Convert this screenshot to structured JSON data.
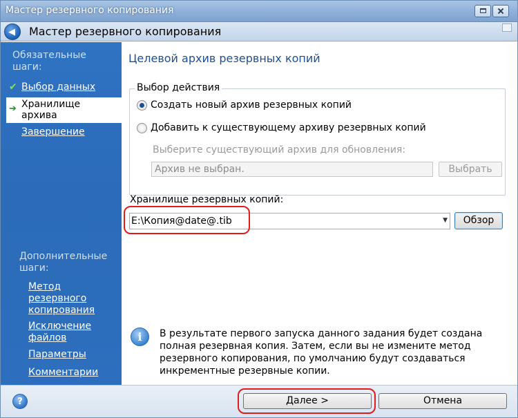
{
  "window": {
    "title": "Мастер резервного копирования",
    "header_title": "Мастер резервного копирования"
  },
  "sidebar": {
    "required_label": "Обязательные шаги:",
    "required_items": [
      {
        "label": "Выбор данных",
        "state": "completed"
      },
      {
        "label": "Хранилище архива",
        "state": "active"
      },
      {
        "label": "Завершение",
        "state": "pending"
      }
    ],
    "optional_label": "Дополнительные шаги:",
    "optional_items": [
      {
        "label": "Метод резервного копирования"
      },
      {
        "label": "Исключение файлов"
      },
      {
        "label": "Параметры"
      },
      {
        "label": "Комментарии"
      }
    ]
  },
  "main": {
    "page_title": "Целевой архив резервных копий",
    "action_group": {
      "legend": "Выбор действия",
      "option_new": "Создать новый архив резервных копий",
      "option_add": "Добавить к существующему архиву резервных копий",
      "selected": "option_new",
      "hint": "Выберите существующий архив для обновления:",
      "archive_field_value": "Архив не выбран.",
      "select_button": "Выбрать"
    },
    "storage": {
      "label": "Хранилище резервных копий:",
      "path_value": "E:\\Копия@date@.tib",
      "browse_button": "Обзор"
    },
    "info_text": "В результате первого запуска данного задания будет создана полная резервная копия. Затем, если вы не измените метод резервного копирования, по умолчанию будут создаваться инкрементные резервные копии."
  },
  "footer": {
    "next_button": "Далее >",
    "cancel_button": "Отмена"
  },
  "icons": {
    "back": "back-arrow-icon",
    "help": "help-icon",
    "info": "info-icon",
    "check": "check-icon",
    "step_arrow": "arrow-right-icon"
  },
  "colors": {
    "sidebar_bg": "#2d6fbe",
    "title_accent": "#1c4f93",
    "highlight_oval": "#e21a1a"
  }
}
